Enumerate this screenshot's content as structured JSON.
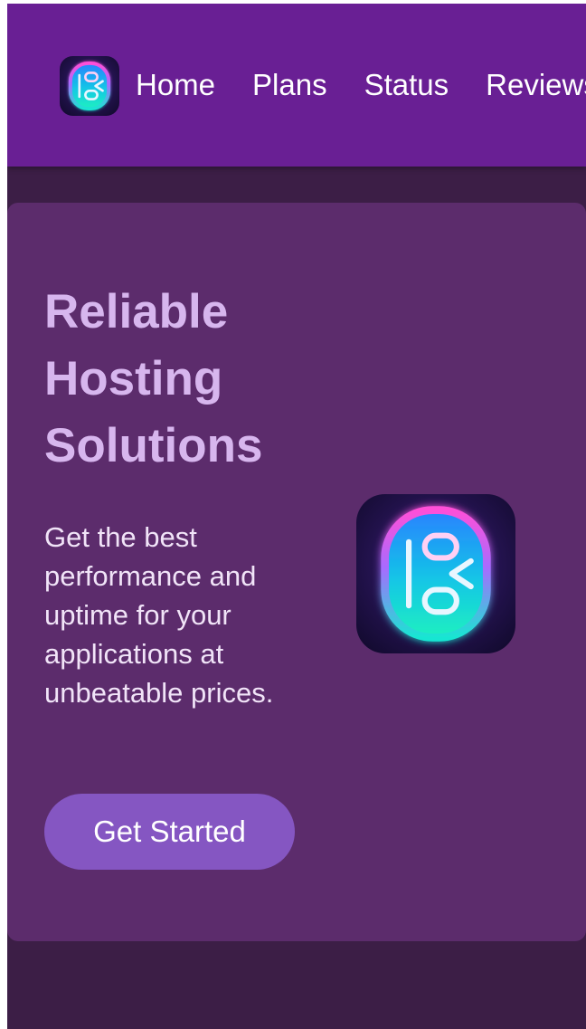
{
  "nav": {
    "logo_icon": "app-logo-icon",
    "links": [
      {
        "label": "Home"
      },
      {
        "label": "Plans"
      },
      {
        "label": "Status"
      },
      {
        "label": "Reviews"
      }
    ]
  },
  "hero": {
    "title": "Reliable Hosting Solutions",
    "description": "Get the best performance and uptime for your applications at unbeatable prices.",
    "cta_label": "Get Started",
    "logo_icon": "app-logo-icon"
  },
  "colors": {
    "nav_bg": "#691f94",
    "page_bg": "#3c1e46",
    "card_bg": "#5c2c6c",
    "title": "#d7b6ee",
    "button": "#8556c2"
  }
}
